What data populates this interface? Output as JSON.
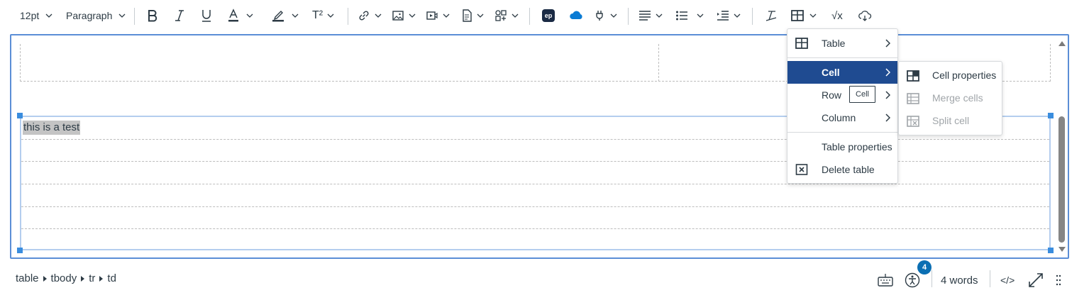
{
  "toolbar": {
    "font_size": "12pt",
    "block_format": "Paragraph",
    "superscript_label": "T²",
    "buttons": {
      "bold": "bold-icon",
      "italic": "italic-icon",
      "underline": "underline-icon",
      "text_color": "text-color-icon",
      "highlight": "highlight-icon",
      "superscript": "superscript-icon",
      "link": "link-icon",
      "image": "image-icon",
      "media": "media-icon",
      "document": "document-icon",
      "apps": "apps-icon",
      "ep": "ep",
      "onedrive": "onedrive-icon",
      "plugin": "plugin-icon",
      "align": "align-icon",
      "list": "list-icon",
      "indent": "indent-icon",
      "clear_format": "clear-format-icon",
      "table": "table-icon",
      "equation": "√x",
      "cloud": "cloud-icon"
    }
  },
  "editor": {
    "cell_text": "this is a test"
  },
  "table_menu": {
    "items": [
      {
        "label": "Table",
        "icon": "table-icon",
        "submenu": true
      },
      {
        "label": "Cell",
        "submenu": true,
        "active": true
      },
      {
        "label": "Row",
        "submenu": true
      },
      {
        "label": "Column",
        "submenu": true
      },
      {
        "label": "Table properties"
      },
      {
        "label": "Delete table",
        "icon": "delete-table-icon"
      }
    ],
    "tooltip": "Cell"
  },
  "cell_submenu": {
    "items": [
      {
        "label": "Cell properties",
        "icon": "cell-properties-icon",
        "enabled": true
      },
      {
        "label": "Merge cells",
        "icon": "merge-cells-icon",
        "enabled": false
      },
      {
        "label": "Split cell",
        "icon": "split-cell-icon",
        "enabled": false
      }
    ]
  },
  "status_bar": {
    "path": [
      "table",
      "tbody",
      "tr",
      "td"
    ],
    "accessibility_count": "4",
    "word_count": "4 words",
    "html_toggle": "</>",
    "icons": [
      "keyboard-icon",
      "accessibility-icon",
      "fullscreen-icon",
      "resize-handle-icon"
    ]
  },
  "colors": {
    "active_menu": "#1f4b91",
    "editor_border": "#5b8ed6",
    "text": "#2d3b45",
    "badge": "#0b6fb3",
    "handle": "#3a8dde"
  }
}
